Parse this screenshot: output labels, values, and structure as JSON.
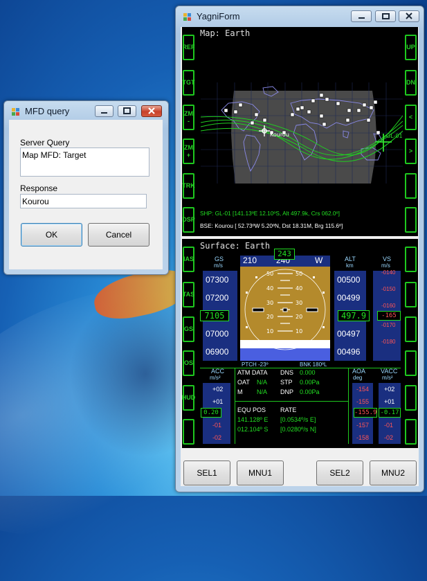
{
  "mfd_query": {
    "title": "MFD query",
    "server_query_label": "Server Query",
    "server_query_value": "Map MFD: Target",
    "response_label": "Response",
    "response_value": "Kourou",
    "ok_label": "OK",
    "cancel_label": "Cancel"
  },
  "yagni": {
    "title": "YagniForm",
    "top_mfd": {
      "left_keys": [
        "REF",
        "TGT",
        "ZM -",
        "ZM +",
        "TRK",
        "DSP"
      ],
      "right_keys": [
        "UP",
        "DN",
        "<",
        ">",
        "",
        ""
      ],
      "map_title": "Map: Earth",
      "ship_line": "SHP:  GL-01 [141.13ºE  12.10ºS, Alt  497.9k, Crs 062.0º]",
      "base_line": "BSE:  Kourou [ 52.73ºW   5.20ºN, Dst 18.31M, Brg 115.6º]",
      "base_label": "Kourou",
      "ship_label": "GL-01"
    },
    "bottom_mfd": {
      "left_keys": [
        "IAS",
        "TAS",
        "GS",
        "OS",
        "HUD",
        ""
      ],
      "right_keys": [
        "",
        "",
        "",
        "",
        "",
        ""
      ],
      "surface_title": "Surface: Earth",
      "heading_ticks": [
        "210",
        "240",
        "W"
      ],
      "heading_value": "243",
      "gs_label": "GS",
      "gs_unit": "m/s",
      "gs_ticks": [
        "07300",
        "07200",
        "07000",
        "06900"
      ],
      "gs_value": "7105",
      "alt_label": "ALT",
      "alt_unit": "km",
      "alt_ticks": [
        "00500",
        "00499",
        "00497",
        "00496"
      ],
      "alt_value": "497.9",
      "vs_label": "VS",
      "vs_unit": "m/s",
      "vs_ticks": [
        "-0140",
        "-0150",
        "-0160",
        "-0170",
        "-0180"
      ],
      "vs_value": "-165",
      "pitch_ladder": [
        "50",
        "40",
        "30",
        "20",
        "10",
        "50",
        "40",
        "30",
        "20",
        "10"
      ],
      "pitch_text": "PTCH -23º",
      "bank_text": "BNK 180ºL",
      "acc_label": "ACC",
      "acc_unit": "m/s²",
      "acc_ticks": [
        "+02",
        "+01",
        "-01",
        "-02"
      ],
      "acc_value": "0.20",
      "atm_header": "ATM DATA",
      "oat_label": "OAT",
      "oat_value": "N/A",
      "m_label": "M",
      "m_value": "N/A",
      "dns_label": "DNS",
      "dns_value": "0.000",
      "stp_label": "STP",
      "stp_value": "0.00Pa",
      "dnp_label": "DNP",
      "dnp_value": "0.00Pa",
      "equ_header": "EQU POS",
      "equ_lon": "141.128º E",
      "equ_lat": "012.104º S",
      "rate_header": "RATE",
      "rate_lon": "[0.0534º/s E]",
      "rate_lat": "[0.0280º/s N]",
      "aoa_label": "AOA",
      "aoa_unit": "deg",
      "aoa_ticks": [
        "-154",
        "-155",
        "-157",
        "-158"
      ],
      "aoa_value": "-155.9",
      "vacc_label": "VACC",
      "vacc_unit": "m/s²",
      "vacc_ticks": [
        "+02",
        "+01",
        "-01",
        "-02"
      ],
      "vacc_value": "-0.17"
    },
    "buttons": [
      "SEL1",
      "MNU1",
      "SEL2",
      "MNU2"
    ]
  },
  "colors": {
    "mfd_green": "#1ec81e",
    "mfd_text_green": "#22e022",
    "tape_blue": "#1a2f80",
    "sky_blue": "#4a5fe0",
    "ground_brown": "#b48a2c",
    "label_cyan": "#9ad8ff"
  }
}
